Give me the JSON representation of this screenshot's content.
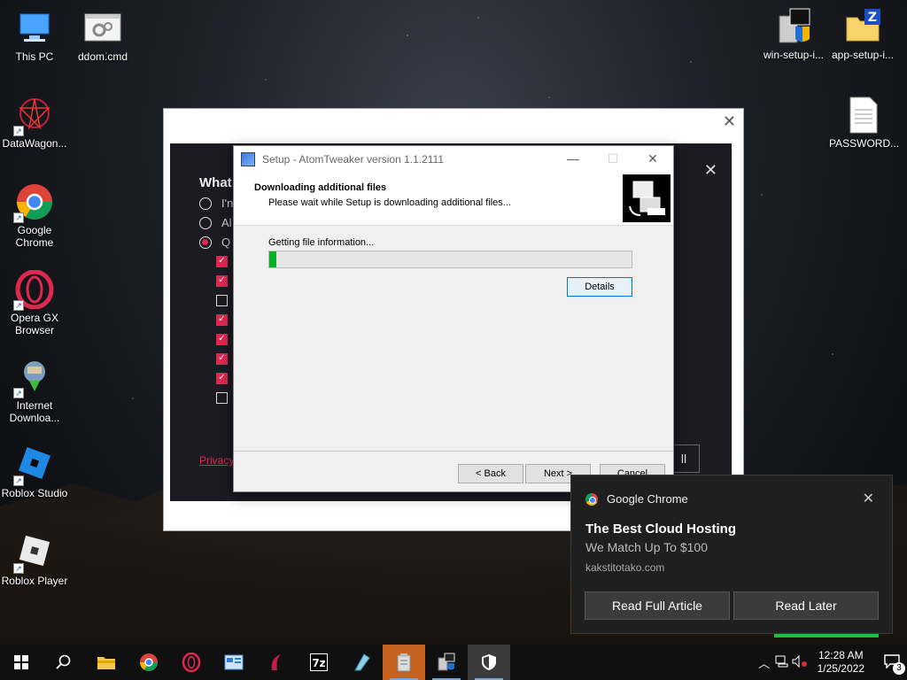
{
  "desktop": {
    "icons_left": [
      {
        "label": "This PC",
        "icon": "computer-icon"
      },
      {
        "label": "DataWagon...",
        "icon": "datawagon-icon"
      },
      {
        "label": "Google Chrome",
        "icon": "chrome-icon"
      },
      {
        "label": "Opera GX Browser",
        "icon": "opera-gx-icon"
      },
      {
        "label": "Internet Downloa...",
        "icon": "internet-download-icon"
      },
      {
        "label": "Roblox Studio",
        "icon": "roblox-studio-icon"
      },
      {
        "label": "Roblox Player",
        "icon": "roblox-player-icon"
      }
    ],
    "icon_ddom": {
      "label": "ddom.cmd",
      "icon": "cmd-file-icon"
    },
    "icons_right": [
      {
        "label": "win-setup-i...",
        "icon": "installer-icon"
      },
      {
        "label": "app-setup-i...",
        "icon": "zip-folder-icon"
      },
      {
        "label": "PASSWORD...",
        "icon": "text-file-icon"
      }
    ]
  },
  "bg_installer": {
    "heading": "What",
    "radios": [
      "I'n",
      "Al",
      "Q"
    ],
    "privacy": "Privacy",
    "button_fragment": "ll",
    "checkboxes": [
      true,
      true,
      false,
      true,
      true,
      true,
      true,
      false
    ]
  },
  "setup": {
    "title": "Setup - AtomTweaker version 1.1.2111",
    "header_title": "Downloading additional files",
    "header_subtitle": "Please wait while Setup is downloading additional files...",
    "status": "Getting file information...",
    "progress_percent": 2,
    "details_label": "Details",
    "back_label": "< Back",
    "next_label": "Next >",
    "cancel_label": "Cancel"
  },
  "toast": {
    "source": "Google Chrome",
    "title": "The Best Cloud Hosting",
    "subtitle": "We Match Up To $100",
    "domain": "kakstitotako.com",
    "btn_primary": "Read Full Article",
    "btn_secondary": "Read Later"
  },
  "taskbar": {
    "time": "12:28 AM",
    "date": "1/25/2022",
    "notifications": "3",
    "apps": [
      "start-icon",
      "search-icon",
      "file-explorer-icon",
      "chrome-icon",
      "opera-icon",
      "control-panel-icon",
      "opera-gx-icon",
      "7zip-icon",
      "pen-icon",
      "archive-icon",
      "installer-icon",
      "shield-icon"
    ]
  }
}
